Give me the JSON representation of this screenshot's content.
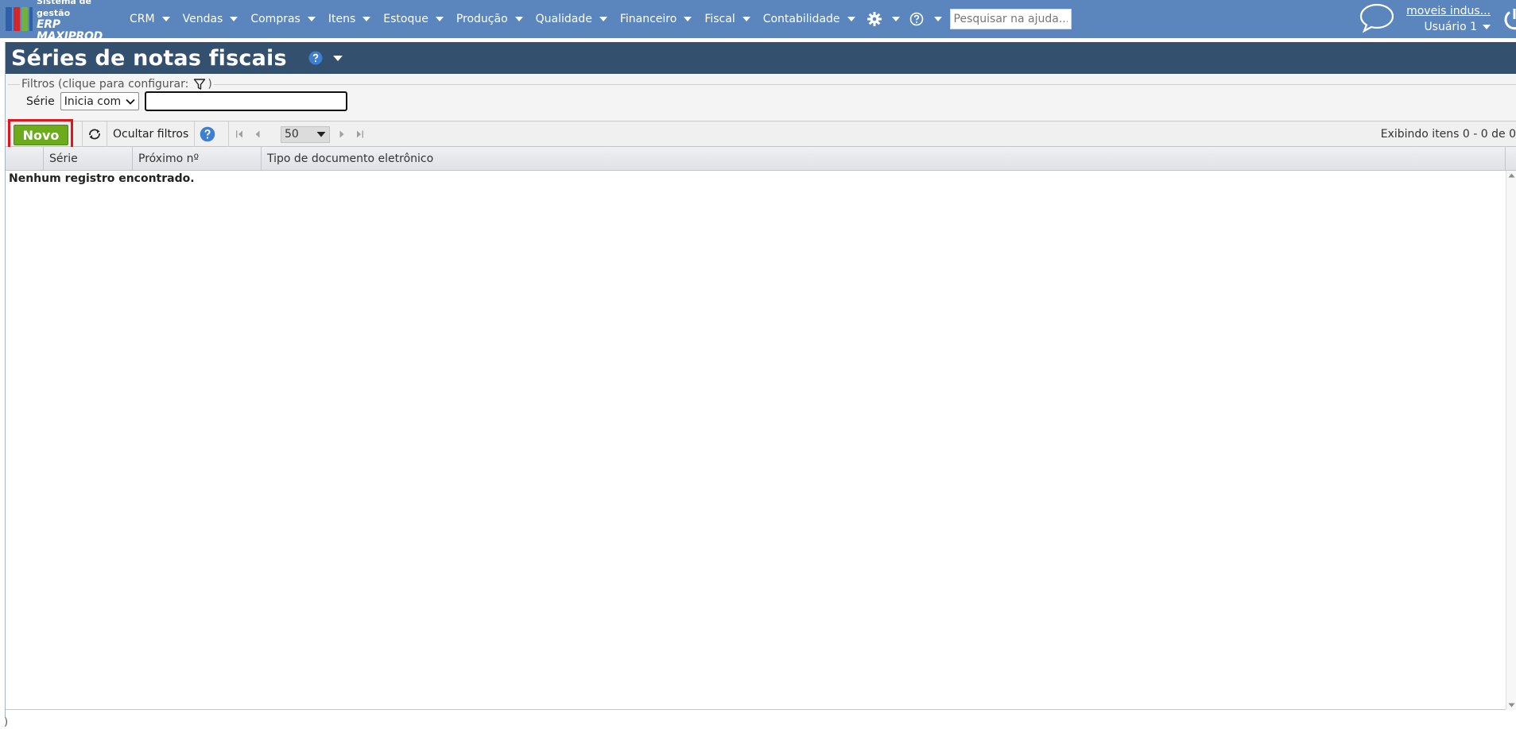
{
  "app": {
    "logo_line1": "Sistema de gestão",
    "logo_line2": "ERP MAXIPROD",
    "logo_colors": [
      "#2e5fa8",
      "#d2262a",
      "#6fb33e"
    ]
  },
  "nav": {
    "items": [
      {
        "label": "CRM"
      },
      {
        "label": "Vendas"
      },
      {
        "label": "Compras"
      },
      {
        "label": "Itens"
      },
      {
        "label": "Estoque"
      },
      {
        "label": "Produção"
      },
      {
        "label": "Qualidade"
      },
      {
        "label": "Financeiro"
      },
      {
        "label": "Fiscal"
      },
      {
        "label": "Contabilidade"
      }
    ],
    "settings_icon": "gear-icon",
    "help_icon": "question-circle-icon",
    "help_search_placeholder": "Pesquisar na ajuda..."
  },
  "user": {
    "company": "moveis indus...",
    "name": "Usuário 1",
    "chat_icon": "chat-bubble-icon",
    "power_icon": "power-icon"
  },
  "page": {
    "title": "Séries de notas fiscais"
  },
  "filters": {
    "legend_prefix": "Filtros (clique para configurar:",
    "legend_suffix": ")",
    "field_label": "Série",
    "operator_selected": "Inicia com",
    "value": ""
  },
  "toolbar": {
    "new_label": "Novo",
    "hide_filters_label": "Ocultar filtros",
    "page_size": "50",
    "status_text": "Exibindo itens 0 - 0 de 0",
    "highlight_color": "#e0151b",
    "new_button_color": "#6bab1c"
  },
  "table": {
    "columns": [
      "Série",
      "Próximo nº",
      "Tipo de documento eletrônico"
    ],
    "empty_message": "Nenhum registro encontrado."
  },
  "footer": {
    "stray_char": ")"
  }
}
